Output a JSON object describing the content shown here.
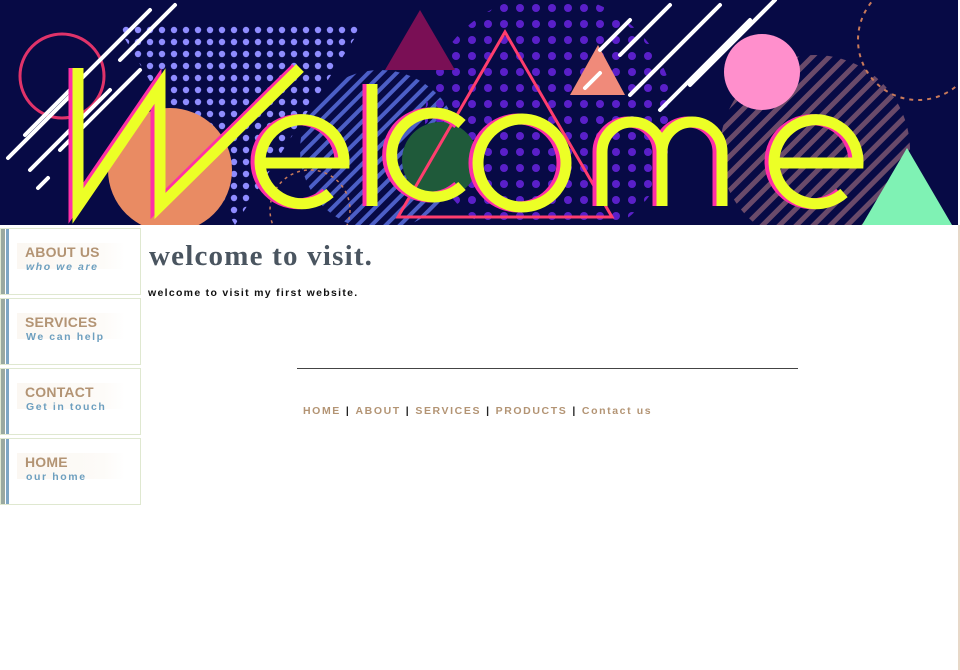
{
  "banner": {
    "word": "Welcome"
  },
  "sidebar": {
    "items": [
      {
        "title": "ABOUT US",
        "subtitle": "who we are"
      },
      {
        "title": "SERVICES",
        "subtitle": "We can help"
      },
      {
        "title": "CONTACT",
        "subtitle": "Get in touch"
      },
      {
        "title": "HOME",
        "subtitle": "our home"
      }
    ]
  },
  "main": {
    "heading": "welcome to visit.",
    "text": "welcome to visit my first website."
  },
  "footer": {
    "links": [
      "HOME",
      "ABOUT",
      "SERVICES",
      "PRODUCTS",
      "Contact us"
    ],
    "separator": "|"
  },
  "colors": {
    "banner_bg": "#070a45",
    "welcome_text": "#ecff26",
    "accent_pink": "#ff3db0",
    "nav_title": "#b39474",
    "nav_subtitle": "#6d9fbf"
  }
}
